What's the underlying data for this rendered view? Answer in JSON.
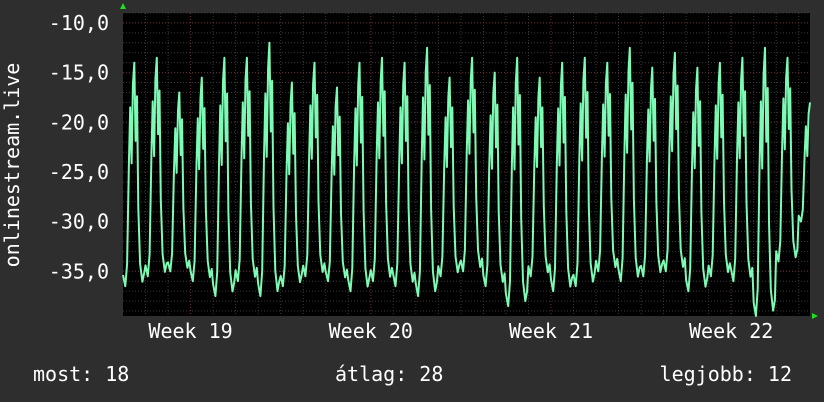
{
  "chart_data": {
    "type": "line",
    "ylabel": "onlinestream.live",
    "ylim": [
      -39.5,
      -9.0
    ],
    "y_ticks": [
      -10,
      -15,
      -20,
      -25,
      -30,
      -35
    ],
    "y_tick_labels": [
      "-10,0",
      "-15,0",
      "-20,0",
      "-25,0",
      "-30,0",
      "-35,0"
    ],
    "x_range_days": [
      0,
      30.5
    ],
    "x_ticks": [
      {
        "label": "Week 19",
        "day": 6.5
      },
      {
        "label": "Week 20",
        "day": 14.5
      },
      {
        "label": "Week 21",
        "day": 22.5
      },
      {
        "label": "Week 22",
        "day": 30.5
      }
    ],
    "grid": true,
    "series": [
      {
        "color": "#7dfab4",
        "daily_pattern": [
          {
            "peak": -14,
            "trough": -36.5
          },
          {
            "peak": -13.5,
            "trough": -35.5
          },
          {
            "peak": -17.0,
            "trough": -35.0
          },
          {
            "peak": -15.5,
            "trough": -36.0
          },
          {
            "peak": -13.5,
            "trough": -37.5
          },
          {
            "peak": -13.5,
            "trough": -36.0
          },
          {
            "peak": -12.0,
            "trough": -37.5
          },
          {
            "peak": -16.0,
            "trough": -36.5
          },
          {
            "peak": -14.0,
            "trough": -35.5
          },
          {
            "peak": -16.5,
            "trough": -36.0
          },
          {
            "peak": -14.0,
            "trough": -37.0
          },
          {
            "peak": -13.5,
            "trough": -36.0
          },
          {
            "peak": -14.0,
            "trough": -36.5
          },
          {
            "peak": -12.5,
            "trough": -37.5
          },
          {
            "peak": -15.5,
            "trough": -35.5
          },
          {
            "peak": -13.5,
            "trough": -35.0
          },
          {
            "peak": -15.0,
            "trough": -36.5
          },
          {
            "peak": -13.5,
            "trough": -38.5
          },
          {
            "peak": -15.5,
            "trough": -35.5
          },
          {
            "peak": -14.0,
            "trough": -37.0
          },
          {
            "peak": -13.5,
            "trough": -36.5
          },
          {
            "peak": -14.0,
            "trough": -35.0
          },
          {
            "peak": -12.5,
            "trough": -36.0
          },
          {
            "peak": -14.5,
            "trough": -35.5
          },
          {
            "peak": -13.0,
            "trough": -35.0
          },
          {
            "peak": -14.5,
            "trough": -37.0
          },
          {
            "peak": -14.0,
            "trough": -35.5
          },
          {
            "peak": -13.5,
            "trough": -36.0
          },
          {
            "peak": -12.5,
            "trough": -39.5
          },
          {
            "peak": -13.5,
            "trough": -34.0
          },
          {
            "peak": -18.0,
            "trough": -30.0
          }
        ]
      }
    ]
  },
  "stats": {
    "most": "most: 18",
    "avg": "átlag: 28",
    "best": "legjobb: 12"
  },
  "colors": {
    "background": "#2e2e2e",
    "plot_background": "#000000",
    "line": "#7dfab4",
    "grid_minor": "#3a3a3a",
    "grid_major": "#6a2a2a",
    "axis_arrow": "#22dd22"
  }
}
